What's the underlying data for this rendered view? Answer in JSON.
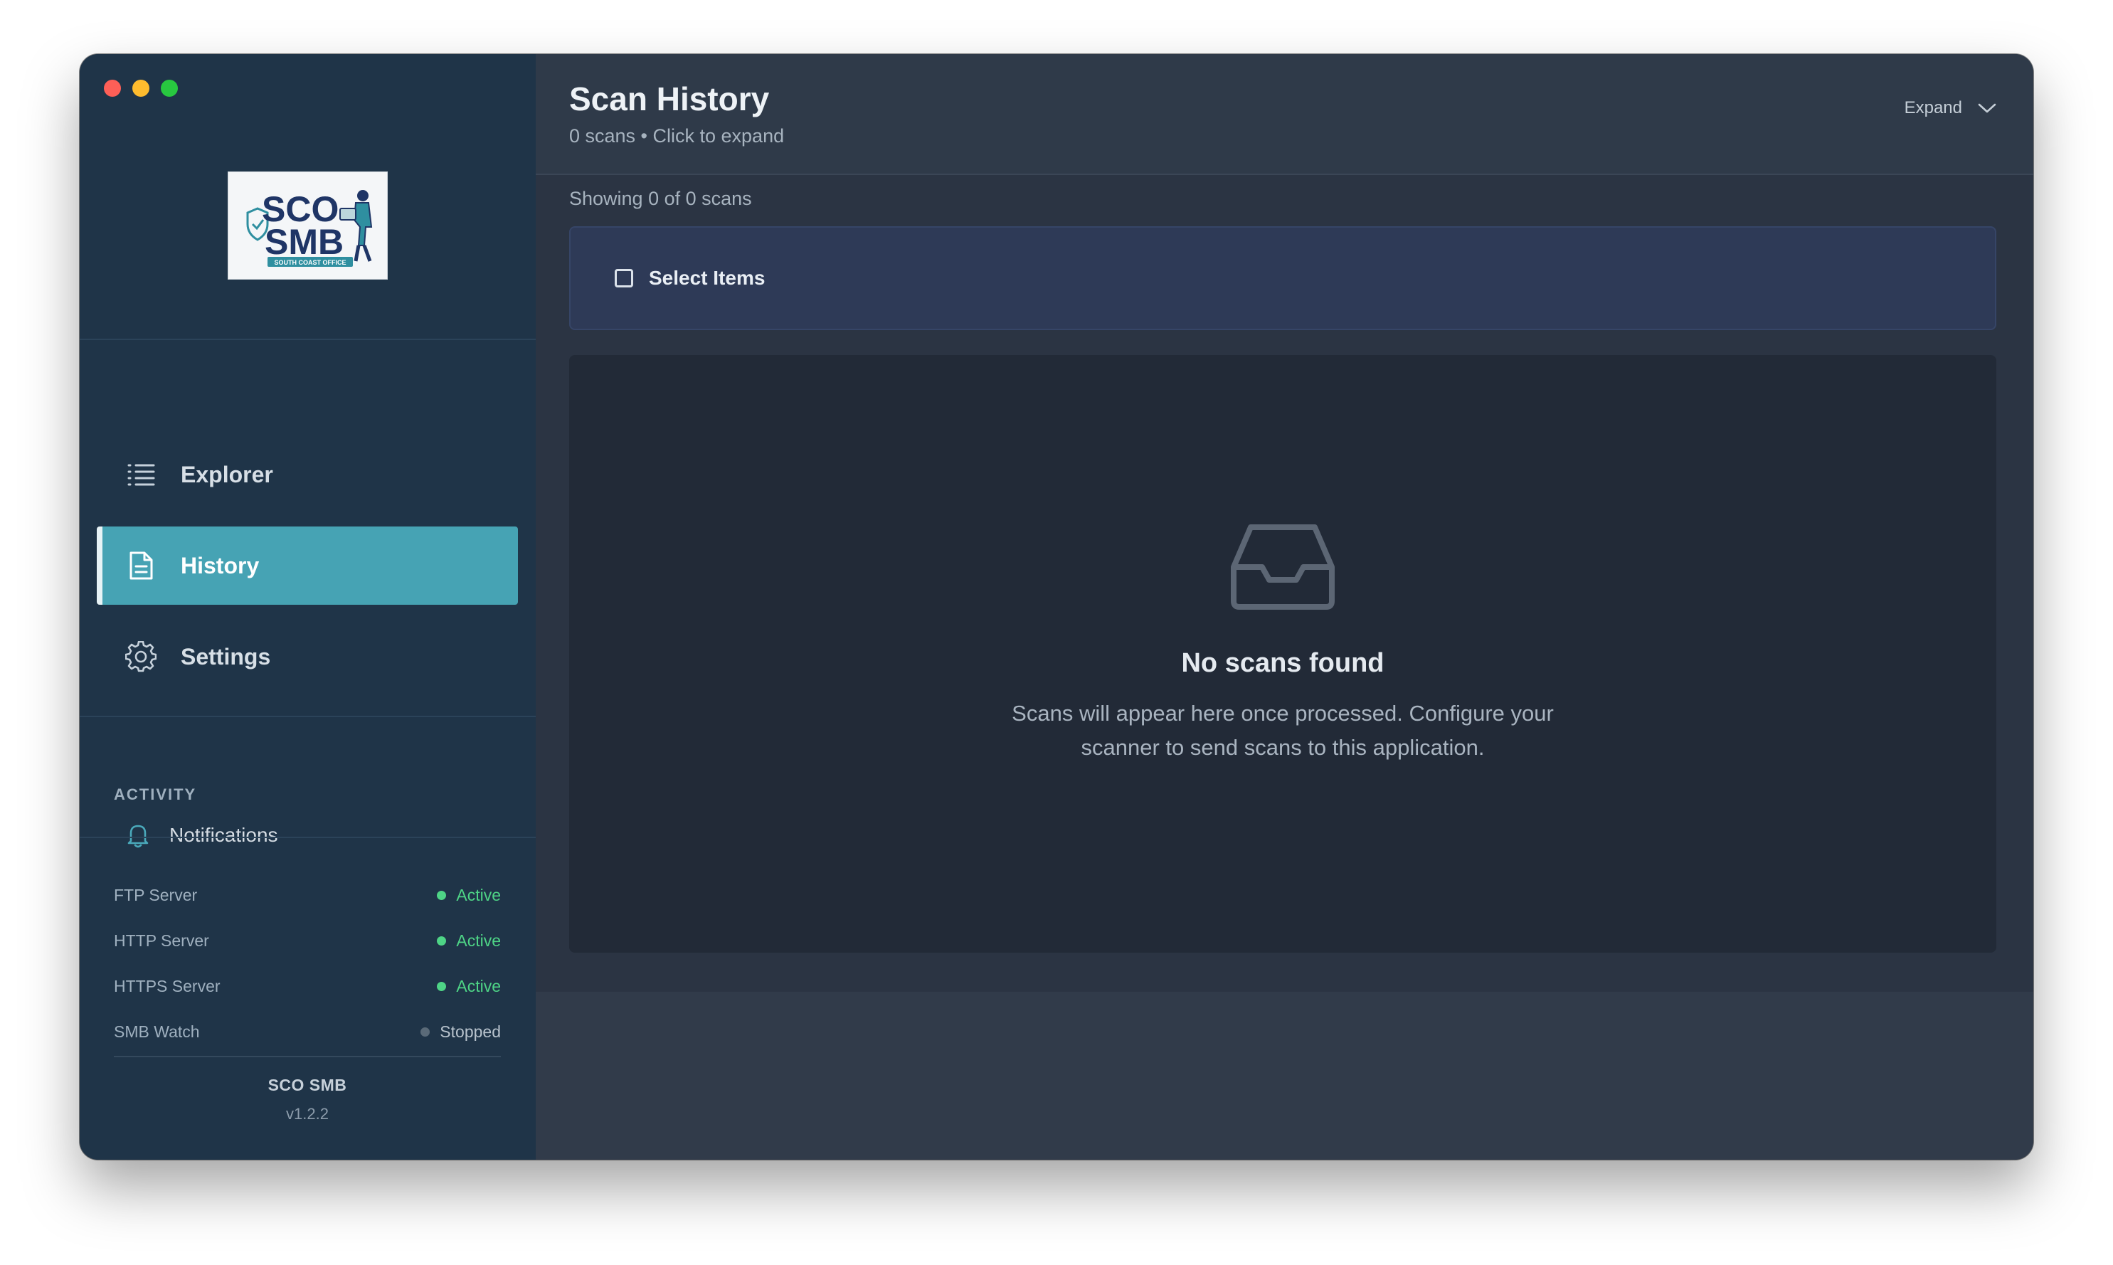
{
  "window": {
    "traffic_lights": [
      "close",
      "minimize",
      "zoom"
    ]
  },
  "sidebar": {
    "logo": {
      "line1": "SCO",
      "line2": "SMB",
      "tagline": "SOUTH COAST OFFICE"
    },
    "nav": [
      {
        "label": "Explorer",
        "icon": "list-icon",
        "active": false
      },
      {
        "label": "History",
        "icon": "document-icon",
        "active": true
      },
      {
        "label": "Settings",
        "icon": "gear-icon",
        "active": false
      }
    ],
    "activity": {
      "title": "ACTIVITY",
      "notifications_label": "Notifications"
    },
    "status": [
      {
        "name": "FTP Server",
        "state": "Active"
      },
      {
        "name": "HTTP Server",
        "state": "Active"
      },
      {
        "name": "HTTPS Server",
        "state": "Active"
      },
      {
        "name": "SMB Watch",
        "state": "Stopped"
      }
    ],
    "footer": {
      "app_name": "SCO SMB",
      "version": "v1.2.2"
    }
  },
  "header": {
    "title": "Scan History",
    "subtitle": "0 scans • Click to expand",
    "expand_label": "Expand"
  },
  "content": {
    "showing_text": "Showing 0 of 0 scans",
    "select_label": "Select Items",
    "empty": {
      "icon": "inbox-icon",
      "title": "No scans found",
      "description": "Scans will appear here once processed. Configure your scanner to send scans to this application."
    }
  },
  "colors": {
    "sidebar_bg": "#1f3448",
    "accent": "#46a3b4",
    "active_status": "#4ed486",
    "stopped_status": "#5a6a78",
    "main_bg": "#2b3443",
    "panel_bg": "#222a37",
    "select_bar_bg": "#2e3a57"
  }
}
